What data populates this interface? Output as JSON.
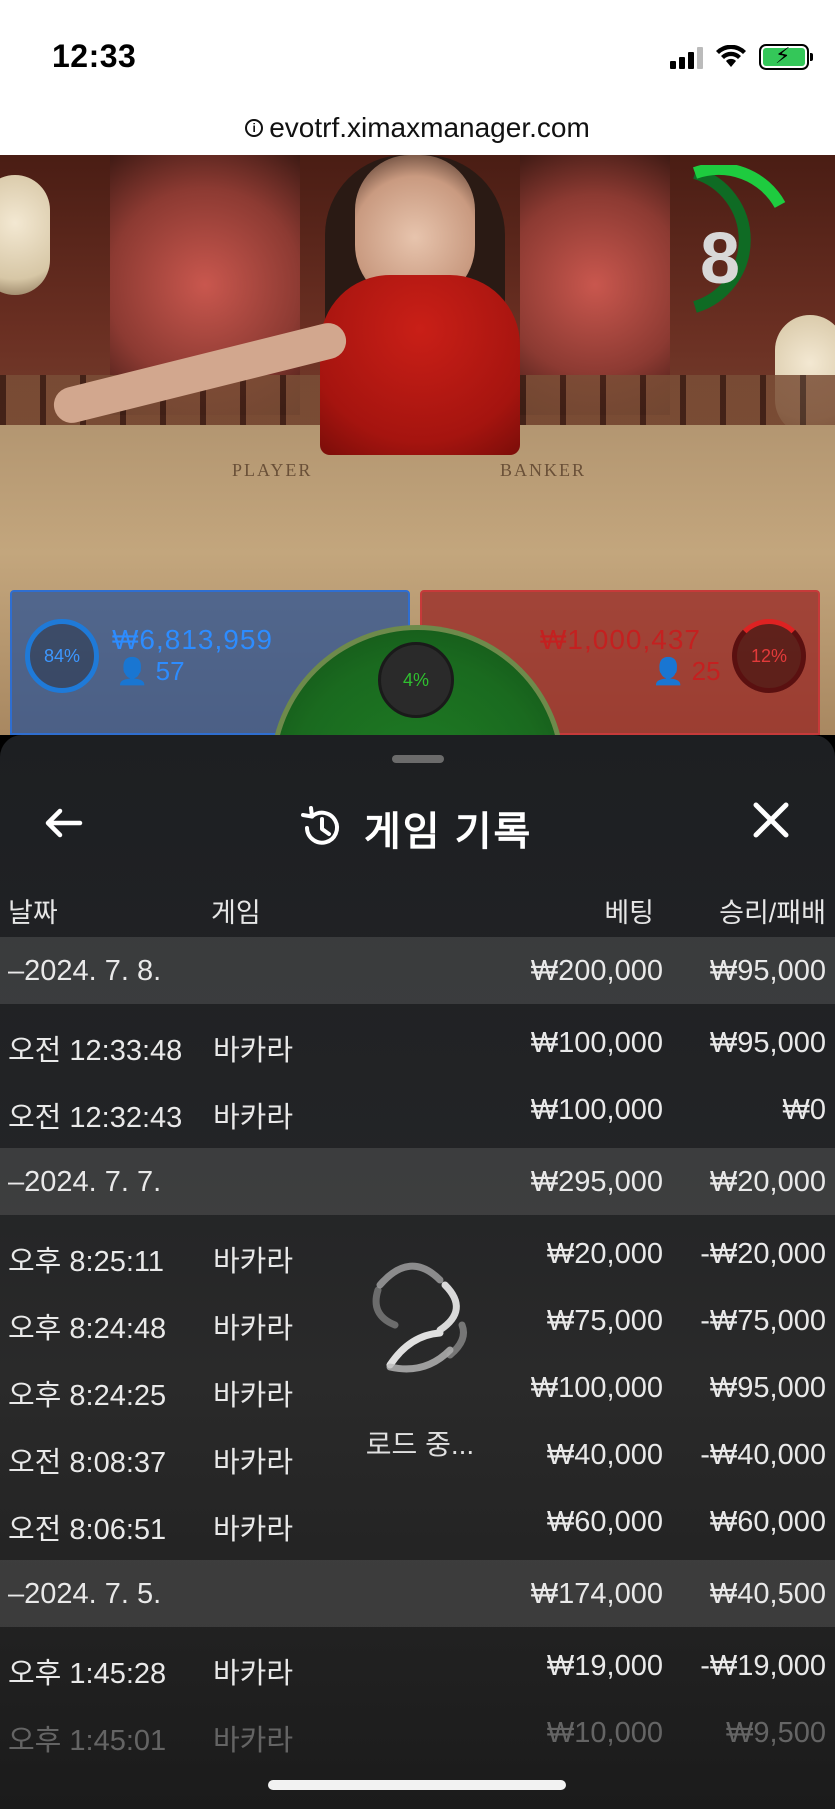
{
  "status_bar": {
    "time": "12:33"
  },
  "browser": {
    "url": "evotrf.ximaxmanager.com"
  },
  "game_overlay": {
    "timer": "8",
    "player": {
      "percent": "84%",
      "amount": "₩6,813,959",
      "count": "57",
      "color": "#3c97ff"
    },
    "banker": {
      "percent": "12%",
      "amount": "₩1,000,437",
      "count": "25",
      "color": "#e23a3a"
    },
    "tie": {
      "percent": "4%",
      "color": "#2fbf2f"
    },
    "table_labels": {
      "player": "PLAYER",
      "banker": "BANKER"
    }
  },
  "history": {
    "title": "게임 기록",
    "columns": {
      "date": "날짜",
      "game": "게임",
      "bet": "베팅",
      "winloss": "승리/패배"
    },
    "loading_text": "로드 중...",
    "rows": [
      {
        "type": "group",
        "date": "–2024. 7. 8.",
        "game": "",
        "bet": "₩200,000",
        "winloss": "₩95,000"
      },
      {
        "type": "item",
        "date": "오전 12:33:48",
        "game": "바카라",
        "bet": "₩100,000",
        "winloss": "₩95,000"
      },
      {
        "type": "item",
        "date": "오전 12:32:43",
        "game": "바카라",
        "bet": "₩100,000",
        "winloss": "₩0"
      },
      {
        "type": "group",
        "date": "–2024. 7. 7.",
        "game": "",
        "bet": "₩295,000",
        "winloss": "₩20,000"
      },
      {
        "type": "item",
        "date": "오후 8:25:11",
        "game": "바카라",
        "bet": "₩20,000",
        "winloss": "-₩20,000"
      },
      {
        "type": "item",
        "date": "오후 8:24:48",
        "game": "바카라",
        "bet": "₩75,000",
        "winloss": "-₩75,000"
      },
      {
        "type": "item",
        "date": "오후 8:24:25",
        "game": "바카라",
        "bet": "₩100,000",
        "winloss": "₩95,000"
      },
      {
        "type": "item",
        "date": "오전 8:08:37",
        "game": "바카라",
        "bet": "₩40,000",
        "winloss": "-₩40,000"
      },
      {
        "type": "item",
        "date": "오전 8:06:51",
        "game": "바카라",
        "bet": "₩60,000",
        "winloss": "₩60,000"
      },
      {
        "type": "group",
        "date": "–2024. 7. 5.",
        "game": "",
        "bet": "₩174,000",
        "winloss": "₩40,500"
      },
      {
        "type": "item",
        "date": "오후 1:45:28",
        "game": "바카라",
        "bet": "₩19,000",
        "winloss": "-₩19,000"
      },
      {
        "type": "faded",
        "date": "오후 1:45:01",
        "game": "바카라",
        "bet": "₩10,000",
        "winloss": "₩9,500"
      }
    ]
  }
}
